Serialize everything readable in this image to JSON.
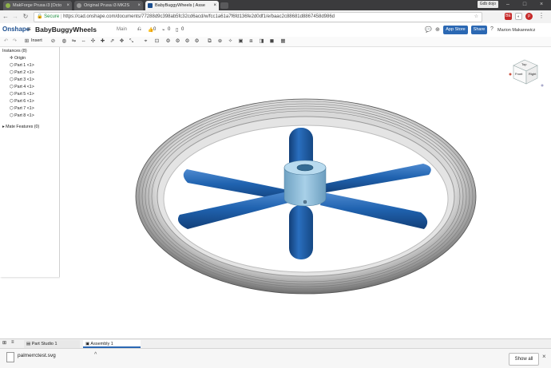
{
  "browser": {
    "tabs": [
      {
        "title": "MakForge Prusa i3 [Octo",
        "active": false
      },
      {
        "title": "Original Prusa i3 MK2S",
        "active": false
      },
      {
        "title": "BabyBuggyWheels | Asse",
        "active": true
      }
    ],
    "user_chip": "Gdb dojo",
    "secure_label": "Secure",
    "url": "https://cad.onshape.com/documents/77288d9c398ab5fc32cd6acd/w/fcc1a61a7f6fd136fe2d0df1/e/baac2c88681d8867458d986d",
    "ext_badge": "BE"
  },
  "onshape": {
    "logo": "Onshape",
    "doc_name": "BabyBuggyWheels",
    "workspace": "Main",
    "likes": "0",
    "links": "0",
    "versions": "0",
    "app_store": "App Store",
    "share": "Share",
    "user_name": "Marion Makarewicz"
  },
  "toolbar": {
    "insert_label": "Insert"
  },
  "instances": {
    "header": "Instances (8)",
    "origin": "Origin",
    "parts": [
      "Part 1 <1>",
      "Part 2 <1>",
      "Part 3 <1>",
      "Part 4 <1>",
      "Part 5 <1>",
      "Part 6 <1>",
      "Part 7 <1>",
      "Part 8 <1>"
    ],
    "mate_features": "Mate Features (0)"
  },
  "viewcube": {
    "top": "Top",
    "front": "Front",
    "right": "Right"
  },
  "bottom_tabs": [
    {
      "label": "Part Studio 1",
      "active": false
    },
    {
      "label": "Assembly 1",
      "active": true
    }
  ],
  "downloads": {
    "file": "palmerrctest.svg",
    "show_all": "Show all"
  },
  "colors": {
    "spoke_blue": "#1f5fa8",
    "hub": "#8cbad6",
    "tire": "#a8a8a8",
    "brand": "#1b4e8f"
  }
}
